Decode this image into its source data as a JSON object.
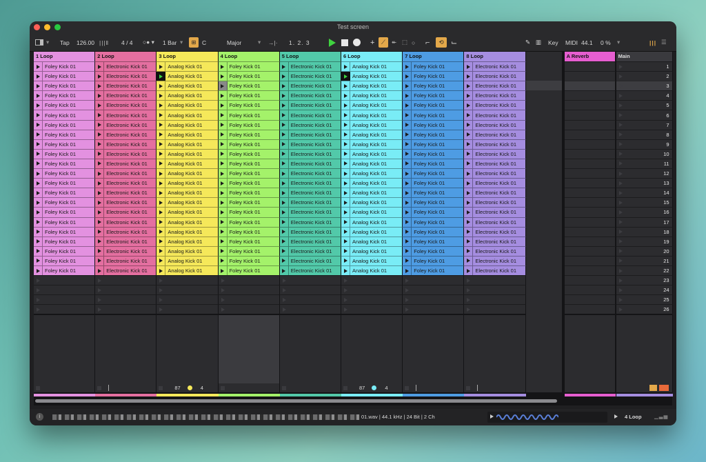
{
  "window": {
    "title": "Test screen"
  },
  "toolbar": {
    "tap": "Tap",
    "tempo": "126.00",
    "signature": "4 / 4",
    "quantize": "1 Bar",
    "key": "C",
    "scale": "Major",
    "position": "1.  2.  3",
    "key_label": "Key",
    "midi_label": "MIDI",
    "sample_rate": "44.1",
    "cpu": "0 %"
  },
  "tracks": [
    {
      "name": "1 Loop",
      "color": "#e391e0",
      "clip": "Foley Kick 01",
      "clips": 22
    },
    {
      "name": "2 Loop",
      "color": "#e46fa0",
      "clip": "Electronic Kick 01",
      "clips": 22
    },
    {
      "name": "3 Loop",
      "color": "#f5e85a",
      "clip": "Analog Kick 01",
      "clips": 22
    },
    {
      "name": "4 Loop",
      "color": "#a4f26a",
      "clip": "Foley Kick 01",
      "clips": 22
    },
    {
      "name": "5 Loop",
      "color": "#52c9a9",
      "clip": "Electronic Kick 01",
      "clips": 22
    },
    {
      "name": "6 Loop",
      "color": "#79ecf6",
      "clip": "Analog Kick 01",
      "clips": 22
    },
    {
      "name": "7 Loop",
      "color": "#4e9ce3",
      "clip": "Foley Kick 01",
      "clips": 22
    },
    {
      "name": "8 Loop",
      "color": "#a58de0",
      "clip": "Electronic Kick 01",
      "clips": 22
    }
  ],
  "returns": [
    {
      "name": "A Reverb",
      "color": "#e65ed0"
    },
    {
      "name": "Main",
      "color": "#a58de0"
    }
  ],
  "scenes": [
    "1",
    "2",
    "3",
    "4",
    "5",
    "6",
    "7",
    "8",
    "9",
    "10",
    "11",
    "12",
    "13",
    "14",
    "15",
    "16",
    "17",
    "18",
    "19",
    "20",
    "21",
    "22",
    "23",
    "24",
    "25",
    "26"
  ],
  "footers": {
    "track3": {
      "left": "87",
      "right": "4"
    },
    "track6": {
      "left": "87",
      "right": "4"
    }
  },
  "status": {
    "file_info": "01.wav | 44.1 kHz | 24 Bit | 2 Ch",
    "selected_track": "4 Loop"
  }
}
